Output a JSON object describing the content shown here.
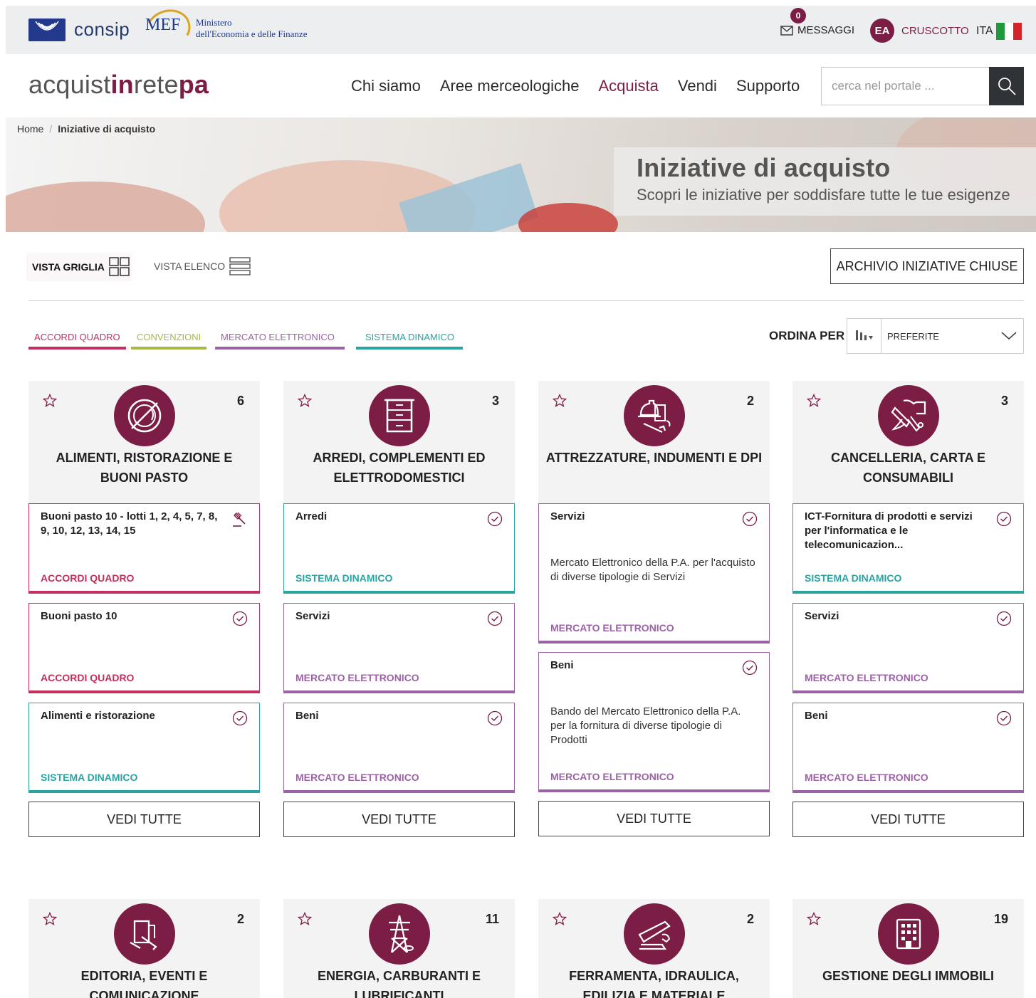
{
  "topbar": {
    "consip": "consip",
    "mef": "MEF",
    "mef_line1": "Ministero",
    "mef_line2": "dell'Economia e delle Finanze",
    "messages_count": "0",
    "messages_label": "MESSAGGI",
    "user_initials": "EA",
    "dashboard_label": "CRUSCOTTO",
    "language": "ITA"
  },
  "brand": {
    "part1": "acquist",
    "part2": "in",
    "part3": "rete",
    "part4": "pa"
  },
  "nav": {
    "items": [
      "Chi siamo",
      "Aree merceologiche",
      "Acquista",
      "Vendi",
      "Supporto"
    ],
    "active": "Acquista"
  },
  "search": {
    "placeholder": "cerca nel portale ..."
  },
  "breadcrumb": {
    "home": "Home",
    "current": "Iniziative di acquisto"
  },
  "hero": {
    "title": "Iniziative di acquisto",
    "subtitle": "Scopri le iniziative per soddisfare tutte le tue esigenze"
  },
  "views": {
    "grid": "VISTA GRIGLIA",
    "list": "VISTA ELENCO",
    "archive": "ARCHIVIO INIZIATIVE CHIUSE"
  },
  "filters": [
    "ACCORDI QUADRO",
    "CONVENZIONI",
    "MERCATO ELETTRONICO",
    "SISTEMA DINAMICO"
  ],
  "sort": {
    "label": "ORDINA PER",
    "value": "PREFERITE"
  },
  "colors": {
    "brand": "#7c1d45",
    "accordi_quadro": "#c2305b",
    "convenzioni": "#a8b64a",
    "mercato_elettronico": "#9b62a6",
    "sistema_dinamico": "#2aa3a3"
  },
  "cards": [
    {
      "icon": "food-plate-icon",
      "count": "6",
      "title": "ALIMENTI, RISTORAZIONE E BUONI PASTO",
      "items": [
        {
          "title": "Buoni pasto 10 - lotti 1, 2, 4, 5, 7, 8, 9, 10, 12, 13, 14, 15",
          "desc": "",
          "type": "ACCORDI QUADRO",
          "status_icon": "auction-gavel-icon"
        },
        {
          "title": "Buoni pasto 10",
          "desc": "",
          "type": "ACCORDI QUADRO",
          "status_icon": "check-circle-icon"
        },
        {
          "title": "Alimenti e ristorazione",
          "desc": "",
          "type": "SISTEMA DINAMICO",
          "status_icon": "check-circle-icon"
        }
      ],
      "more": "VEDI TUTTE"
    },
    {
      "icon": "cabinet-icon",
      "count": "3",
      "title": "ARREDI, COMPLEMENTI ED ELETTRODOMESTICI",
      "items": [
        {
          "title": "Arredi",
          "desc": "",
          "type": "SISTEMA DINAMICO",
          "status_icon": "check-circle-icon"
        },
        {
          "title": "Servizi",
          "desc": "",
          "type": "MERCATO ELETTRONICO",
          "status_icon": "check-circle-icon"
        },
        {
          "title": "Beni",
          "desc": "",
          "type": "MERCATO ELETTRONICO",
          "status_icon": "check-circle-icon"
        }
      ],
      "more": "VEDI TUTTE"
    },
    {
      "icon": "tools-icon",
      "count": "2",
      "title": "ATTREZZATURE, INDUMENTI E DPI",
      "items": [
        {
          "title": "Servizi",
          "desc": "Mercato Elettronico della P.A. per l'acquisto di diverse tipologie di Servizi",
          "type": "MERCATO ELETTRONICO",
          "status_icon": "check-circle-icon"
        },
        {
          "title": "Beni",
          "desc": "Bando del Mercato Elettronico della P.A. per la fornitura di diverse tipologie di Prodotti",
          "type": "MERCATO ELETTRONICO",
          "status_icon": "check-circle-icon"
        }
      ],
      "more": "VEDI TUTTE"
    },
    {
      "icon": "stationery-icon",
      "count": "3",
      "title": "CANCELLERIA, CARTA E CONSUMABILI",
      "items": [
        {
          "title": "ICT-Fornitura di prodotti e servizi per l'informatica e le telecomunicazion...",
          "desc": "",
          "type": "SISTEMA DINAMICO",
          "status_icon": "check-circle-icon"
        },
        {
          "title": "Servizi",
          "desc": "",
          "type": "MERCATO ELETTRONICO",
          "status_icon": "check-circle-icon"
        },
        {
          "title": "Beni",
          "desc": "",
          "type": "MERCATO ELETTRONICO",
          "status_icon": "check-circle-icon"
        }
      ],
      "more": "VEDI TUTTE"
    },
    {
      "icon": "book-icon",
      "count": "2",
      "title": "EDITORIA, EVENTI E COMUNICAZIONE"
    },
    {
      "icon": "power-pylon-icon",
      "count": "11",
      "title": "ENERGIA, CARBURANTI E LUBRIFICANTI"
    },
    {
      "icon": "hardware-tools-icon",
      "count": "2",
      "title": "FERRAMENTA, IDRAULICA, EDILIZIA E MATERIALE ELETTRICO"
    },
    {
      "icon": "building-icon",
      "count": "19",
      "title": "GESTIONE DEGLI IMMOBILI"
    }
  ]
}
